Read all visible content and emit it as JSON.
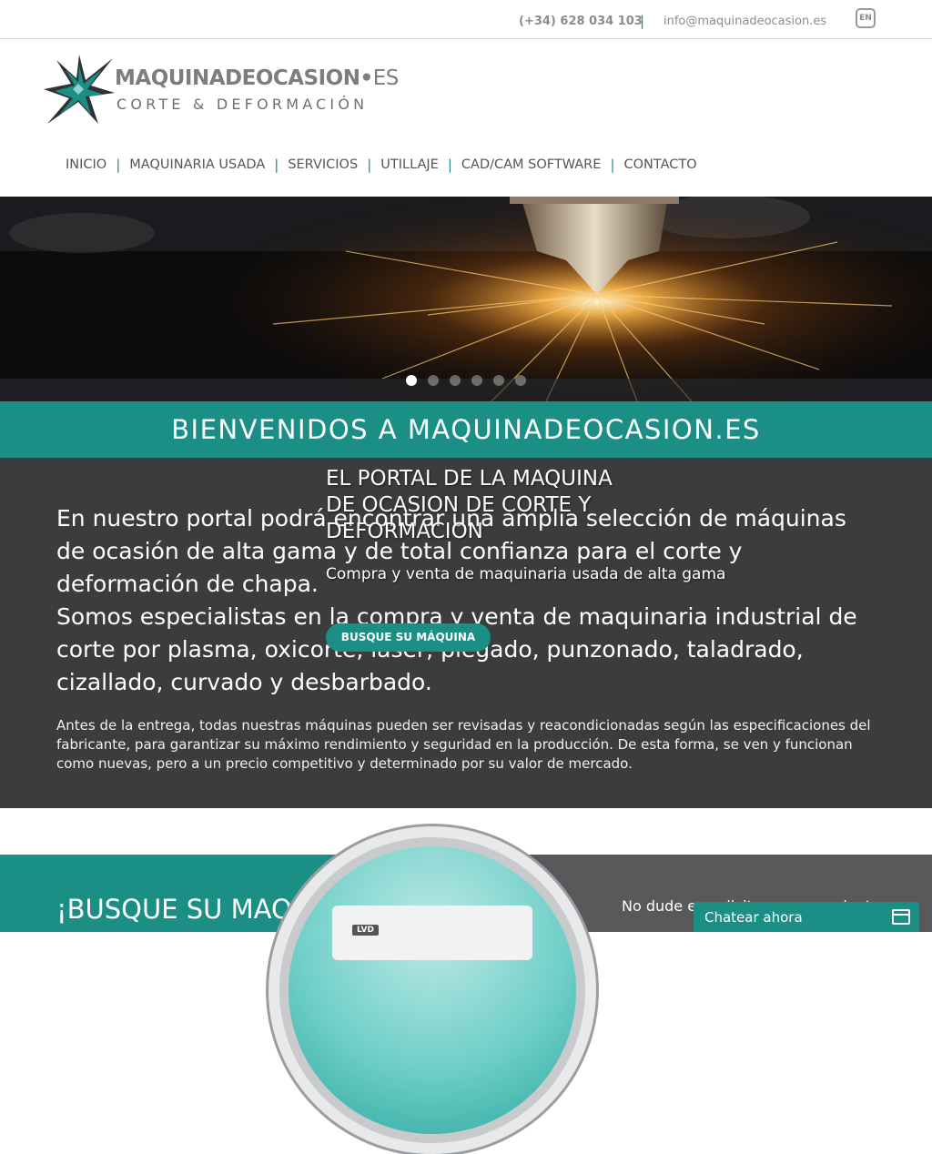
{
  "topbar": {
    "phone": "(+34) 628 034 103",
    "separator": "|",
    "email": "info@maquinadeocasion.es",
    "lang": "EN"
  },
  "logo": {
    "brand_main": "MAQUINADEOCASION",
    "brand_dot": "•",
    "brand_tld": "ES",
    "tagline": "CORTE & DEFORMACIÓN"
  },
  "nav": {
    "items": [
      "INICIO",
      "MAQUINARIA USADA",
      "SERVICIOS",
      "UTILLAJE",
      "CAD/CAM SOFTWARE",
      "CONTACTO"
    ],
    "separator": "|"
  },
  "hero": {
    "title": "EL PORTAL DE LA MAQUINA DE OCASION DE CORTE Y DEFORMACION",
    "subtitle": "Compra y venta de maquinaria usada de alta gama",
    "button": "BUSQUE SU MÁQUINA",
    "slide_count": 6,
    "active_slide": 1
  },
  "welcome": {
    "heading": "BIENVENIDOS A MAQUINADEOCASION.ES",
    "lead": "En nuestro portal podrá encontrar una amplia selección de máquinas de ocasión de alta gama y de total confianza para el corte y deformación de chapa.\nSomos especialistas en la compra y venta de maquinaria industrial de corte por plasma, oxicorte, láser, plegado, punzonado, taladrado, cizallado, curvado y desbarbado.",
    "body": "Antes de la entrega, todas nuestras máquinas pueden ser revisadas y reacondicionadas según las especificaciones del fabricante, para garantizar su máximo rendimiento y seguridad en la producción. De esta forma, se ven y funcionan como nuevas, pero a un precio competitivo y determinado por su valor de mercado."
  },
  "bottom": {
    "heading": "¡BUSQUE SU MAQUINA!",
    "text": "No dude en solicitar asesoramiento",
    "machine_brand": "LVD"
  },
  "chat": {
    "label": "Chatear ahora"
  },
  "colors": {
    "accent": "#1b8e86",
    "dark": "#3b3c3e",
    "grey_panel": "#58595b"
  }
}
